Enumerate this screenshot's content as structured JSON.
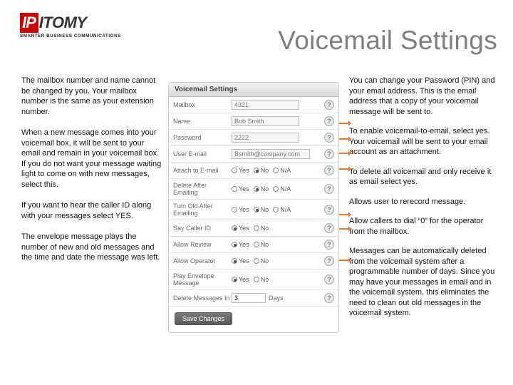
{
  "logo": {
    "ip": "IP",
    "itomy": "ITOMY",
    "tagline": "SMARTER BUSINESS COMMUNICATIONS"
  },
  "title": "Voicemail Settings",
  "left": {
    "p1": "The mailbox number and name cannot be changed by you.  Your mailbox number is the same as your extension number.",
    "p2": "When a new message comes into your voicemail box, it will be sent to your email and remain in your voicemail box.  If you do not want your message waiting light to come on with new messages, select this.",
    "p3": "If you want to hear the caller ID along with your messages select YES.",
    "p4": "The envelope message plays the number of new and old messages and the time and date the message was left."
  },
  "right": {
    "p1": "You can change your Password (PIN) and your email address.  This is the email address that a copy of your voicemail message will be sent to.",
    "p2": "To enable voicemail-to-email, select yes.  Your voicemail will be sent to your email account as an attachment.",
    "p3": "To delete all voicemail and only receive it as email select yes.",
    "p4": "Allows user to rerecord message.",
    "p5": "Allow callers to dial “0” for the operator from the mailbox.",
    "p6": "Messages can be automatically deleted from the voicemail system after a programmable number of days.  Since you may have your messages in email and in the voicemail system, this eliminates the need to clean out old messages in the voicemail system."
  },
  "panel": {
    "heading": "Voicemail Settings",
    "mailbox_label": "Mailbox",
    "mailbox_value": "4321",
    "name_label": "Name",
    "name_value": "Bob Smith",
    "password_label": "Password",
    "password_value": "2222",
    "email_label": "User E-mail",
    "email_value": "Bsmith@company.com",
    "attach_label": "Attach to E-mail",
    "delete_label": "Delete After Emailing",
    "turnold_label": "Turn Old After Emailing",
    "caller_label": "Say Caller ID",
    "review_label": "Allow Review",
    "operator_label": "Allow Operator",
    "envelope_label": "Play Envelope Message",
    "deletein_label": "Delete Messages In",
    "days_value": "3",
    "days_unit": "Days",
    "yes": "Yes",
    "no": "No",
    "na": "N/A",
    "save": "Save Changes",
    "help": "?"
  }
}
